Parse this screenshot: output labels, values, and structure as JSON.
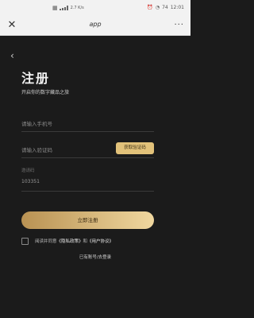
{
  "status_bar": {
    "left_icons_text": "▦",
    "network": "2.7\nK/s",
    "battery": "74",
    "time": "12:01"
  },
  "nav": {
    "close": "✕",
    "title": "app",
    "more": "···"
  },
  "page": {
    "back": "‹",
    "title": "注册",
    "subtitle": "开启你的数字藏品之旅"
  },
  "form": {
    "phone_placeholder": "请输入手机号",
    "code_placeholder": "请输入验证码",
    "get_code_button": "获取验证码",
    "invite_label": "邀请码",
    "invite_value": "103351",
    "submit_label": "立即注册"
  },
  "agreement": {
    "prefix": "阅读并同意",
    "privacy_link": "《隐私政策》",
    "and": "和",
    "user_link": "《用户协议》"
  },
  "footer": {
    "login_link": "已有账号/去登录"
  },
  "colors": {
    "accent_gold": "#e2c27a",
    "background": "#1b1b1b"
  }
}
